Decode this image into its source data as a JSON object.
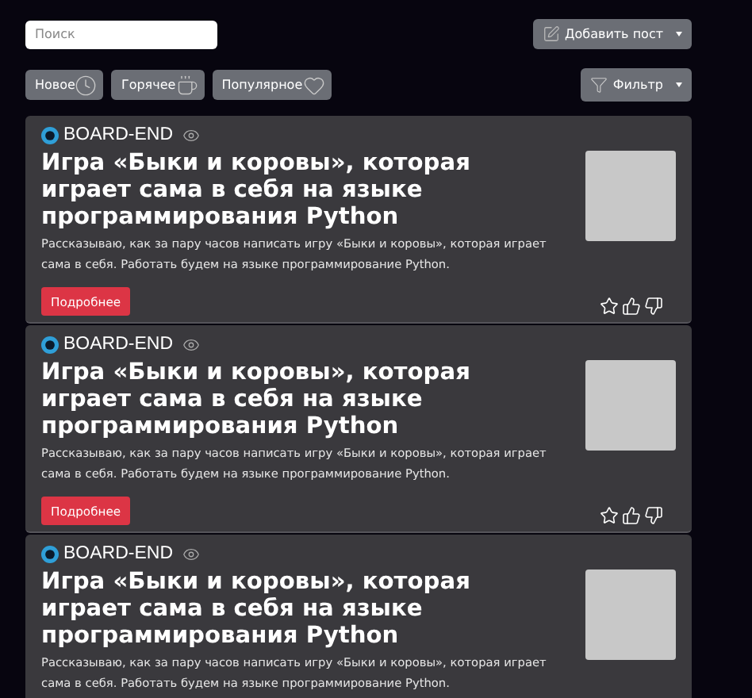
{
  "search": {
    "placeholder": "Поиск"
  },
  "add_post_button": {
    "label": "Добавить пост"
  },
  "sort_tabs": [
    {
      "label": "Новое",
      "kind": "clock",
      "selected": false
    },
    {
      "label": "Горячее",
      "kind": "cup",
      "selected": false
    },
    {
      "label": "Популярное",
      "kind": "heart",
      "selected": false
    }
  ],
  "filter_button": {
    "label": "Фильтр"
  },
  "posts": [
    {
      "author": "BOARD-END",
      "title": "Игра «Быки и коровы», которая играет сама в себя на языке программирования Python",
      "description": "Рассказываю, как за пару часов написать игру «Быки и коровы», которая играет сама в себя. Работать будем на языке программирование Python.",
      "more_button": "Подробнее"
    },
    {
      "author": "BOARD-END",
      "title": "Игра «Быки и коровы», которая играет сама в себя на языке программирования Python",
      "description": "Рассказываю, как за пару часов написать игру «Быки и коровы», которая играет сама в себя. Работать будем на языке программирование Python.",
      "more_button": "Подробнее"
    },
    {
      "author": "BOARD-END",
      "title": "Игра «Быки и коровы», которая играет сама в себя на языке программирования Python",
      "description": "Рассказываю, как за пару часов написать игру «Быки и коровы», которая играет сама в себя. Работать будем на языке программирование Python."
    }
  ]
}
